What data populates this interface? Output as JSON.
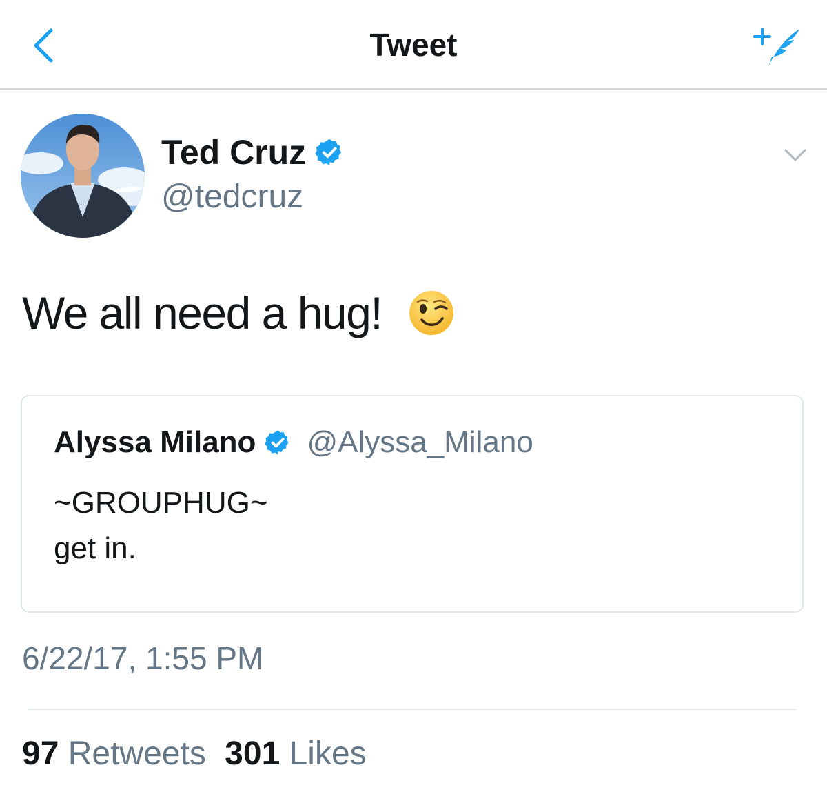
{
  "nav": {
    "title": "Tweet",
    "back_icon": "chevron-left-icon",
    "compose_icon": "compose-tweet-icon",
    "accent_color": "#1da1f2"
  },
  "tweet": {
    "author": {
      "name": "Ted Cruz",
      "handle": "@tedcruz",
      "verified": true
    },
    "text": "We all need a hug!",
    "emoji": "winking-face",
    "quoted": {
      "name": "Alyssa Milano",
      "handle": "@Alyssa_Milano",
      "verified": true,
      "lines": [
        "~GROUPHUG~",
        "get in."
      ]
    },
    "timestamp": "6/22/17, 1:55 PM",
    "stats": {
      "retweets_count": "97",
      "retweets_label": "Retweets",
      "likes_count": "301",
      "likes_label": "Likes"
    }
  },
  "colors": {
    "verified_badge": "#1da1f2",
    "secondary_text": "#657786",
    "primary_text": "#14171a"
  }
}
